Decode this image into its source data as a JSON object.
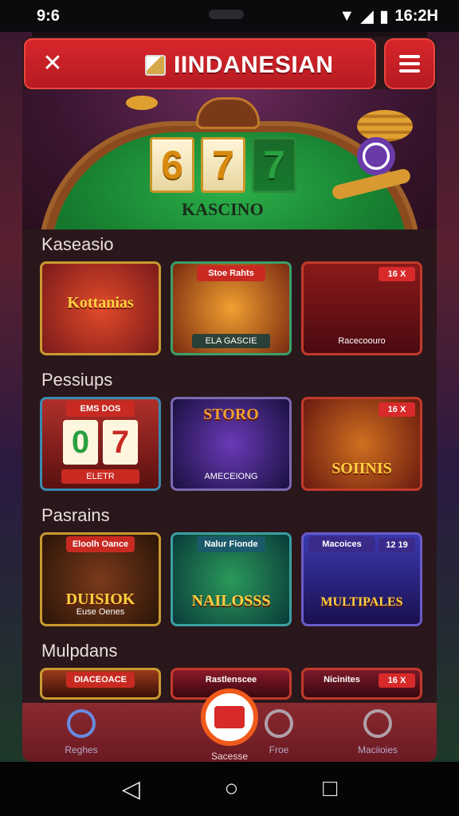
{
  "status_bar": {
    "time_left": "9:6",
    "time_right": "16:2H"
  },
  "header": {
    "title": "IINDANESIAN"
  },
  "hero": {
    "reels": [
      "6",
      "7",
      "7"
    ],
    "label": "KASCINO"
  },
  "sections": [
    {
      "title": "Kaseasio",
      "cards": [
        {
          "title": "Kottanias",
          "tag": "",
          "sub": "",
          "badge": ""
        },
        {
          "title": "",
          "tag": "Stoe Rahts",
          "sub": "ELA GASCIE",
          "badge": ""
        },
        {
          "title": "",
          "tag": "",
          "sub": "Racecoouro",
          "badge": "16 X"
        }
      ]
    },
    {
      "title": "Pessiups",
      "cards": [
        {
          "title": "",
          "tag": "EMS DOS",
          "sub": "ELETR",
          "badge": "",
          "reels": [
            "0",
            "7"
          ]
        },
        {
          "title": "STORO",
          "tag": "",
          "sub": "AMECEIONG",
          "badge": ""
        },
        {
          "title": "SOIINIS",
          "tag": "",
          "sub": "",
          "badge": "16 X"
        }
      ]
    },
    {
      "title": "Pasrains",
      "cards": [
        {
          "title": "DUISIOK",
          "tag": "Eloolh Oance",
          "sub": "Euse Oenes",
          "badge": ""
        },
        {
          "title": "NAILOSSS",
          "tag": "Nalur Fionde",
          "sub": "",
          "badge": ""
        },
        {
          "title": "MULTIPALES",
          "tag": "Macoices",
          "sub": "",
          "badge": "12 19"
        }
      ]
    },
    {
      "title": "Mulpdans",
      "cards": [
        {
          "tag": "DIACEOACE"
        },
        {
          "tag": "Rastlenscee"
        },
        {
          "tag": "Nicinites",
          "badge": "16 X"
        }
      ]
    }
  ],
  "bottom_nav": {
    "items": [
      {
        "label": "Reghes"
      },
      {
        "label": "Sacesse"
      },
      {
        "label": "Froe"
      },
      {
        "label": "Maciioies"
      }
    ]
  }
}
